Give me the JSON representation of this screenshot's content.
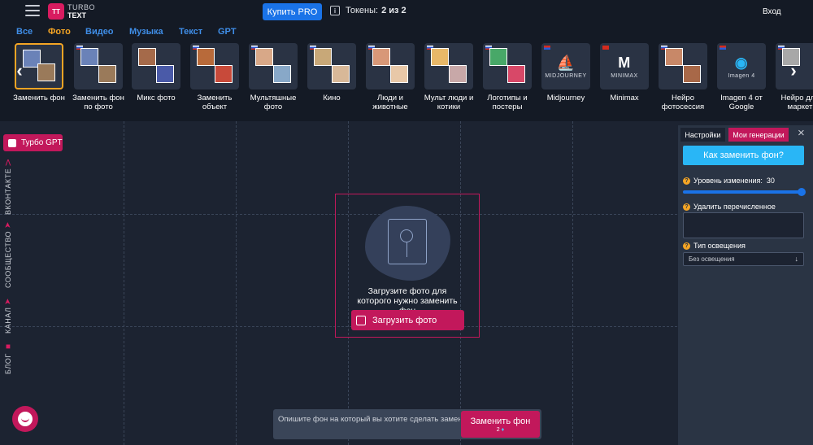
{
  "header": {
    "logo_mark": "TT",
    "logo_line1": "TURBO",
    "logo_line2": "TEXT",
    "buy_label": "Купить PRO",
    "tokens_label": "Токены:",
    "tokens_value": "2 из 2",
    "login_label": "Вход"
  },
  "tabs": [
    {
      "label": "Все",
      "active": false
    },
    {
      "label": "Фото",
      "active": true
    },
    {
      "label": "Видео",
      "active": false
    },
    {
      "label": "Музыка",
      "active": false
    },
    {
      "label": "Текст",
      "active": false
    },
    {
      "label": "GPT",
      "active": false
    }
  ],
  "tools": [
    {
      "label": "Заменить фон",
      "active": true
    },
    {
      "label": "Заменить фон по фото"
    },
    {
      "label": "Микс фото"
    },
    {
      "label": "Заменить объект"
    },
    {
      "label": "Мультяшные фото"
    },
    {
      "label": "Кино"
    },
    {
      "label": "Люди и животные"
    },
    {
      "label": "Мульт люди и котики"
    },
    {
      "label": "Логотипы и постеры"
    },
    {
      "label": "Midjourney",
      "brand": "MIDJOURNEY"
    },
    {
      "label": "Minimax",
      "brand": "MINIMAX"
    },
    {
      "label": "Нейро фотосессия"
    },
    {
      "label": "Imagen 4 от Google",
      "brand": "Imagen 4"
    },
    {
      "label": "Нейро для маркет"
    }
  ],
  "sidebar": {
    "gpt_label": "Турбо GPT",
    "vk_label": "ВКОНТАКТЕ",
    "community_label": "СООБЩЕСТВО",
    "channel_label": "КАНАЛ",
    "blog_label": "БЛОГ"
  },
  "upload": {
    "prompt_text": "Загрузите фото для которого нужно заменить фон",
    "button_label": "Загрузить фото"
  },
  "prompt_bar": {
    "placeholder": "Опишите фон на который вы хотите сделать замену",
    "submit_label": "Заменить фон",
    "cost": "2"
  },
  "panel": {
    "tab_settings": "Настройки",
    "tab_generations": "Мои генерации",
    "close_icon": "×",
    "how_button": "Как заменить фон?",
    "change_level_label": "Уровень изменения:",
    "change_level_value": "30",
    "change_level_fraction": 1.0,
    "remove_label": "Удалить перечисленное",
    "lighting_label": "Тип освещения",
    "lighting_value": "Без освещения"
  },
  "colors": {
    "accent": "#c2185b",
    "tab_active": "#f5a524",
    "tab_link": "#3f8ee8",
    "primary_blue": "#1a73e8",
    "cyan": "#29b6f6"
  }
}
